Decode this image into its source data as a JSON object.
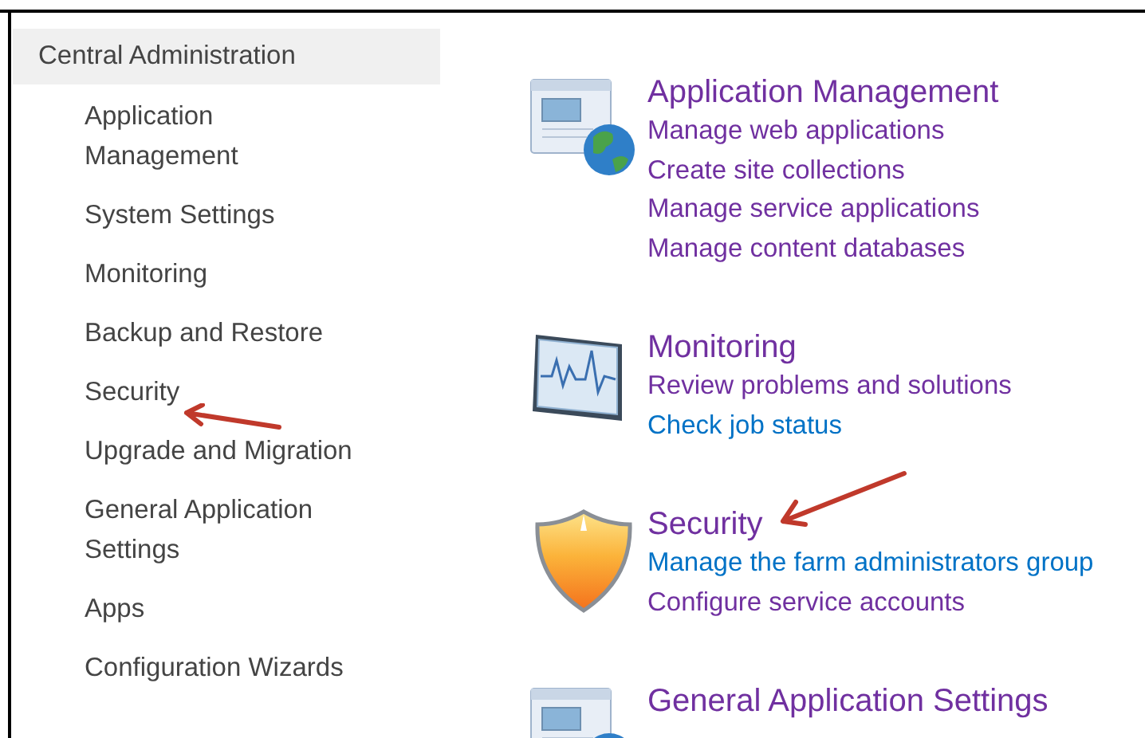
{
  "sidebar": {
    "header": "Central Administration",
    "items": [
      {
        "label": "Application Management",
        "selected": false
      },
      {
        "label": "System Settings",
        "selected": false
      },
      {
        "label": "Monitoring",
        "selected": false
      },
      {
        "label": "Backup and Restore",
        "selected": false
      },
      {
        "label": "Security",
        "selected": false
      },
      {
        "label": "Upgrade and Migration",
        "selected": false
      },
      {
        "label": "General Application Settings",
        "selected": false
      },
      {
        "label": "Apps",
        "selected": false
      },
      {
        "label": "Configuration Wizards",
        "selected": false
      }
    ]
  },
  "sections": [
    {
      "kind": "application",
      "title": "Application Management",
      "links": [
        {
          "label": "Manage web applications",
          "visited": true
        },
        {
          "label": "Create site collections",
          "visited": true
        },
        {
          "label": "Manage service applications",
          "visited": true
        },
        {
          "label": "Manage content databases",
          "visited": true
        }
      ]
    },
    {
      "kind": "monitoring",
      "title": "Monitoring",
      "links": [
        {
          "label": "Review problems and solutions",
          "visited": true
        },
        {
          "label": "Check job status",
          "visited": false
        }
      ]
    },
    {
      "kind": "security",
      "title": "Security",
      "links": [
        {
          "label": "Manage the farm administrators group",
          "visited": false
        },
        {
          "label": "Configure service accounts",
          "visited": true
        }
      ]
    },
    {
      "kind": "application",
      "title": "General Application Settings"
    }
  ]
}
